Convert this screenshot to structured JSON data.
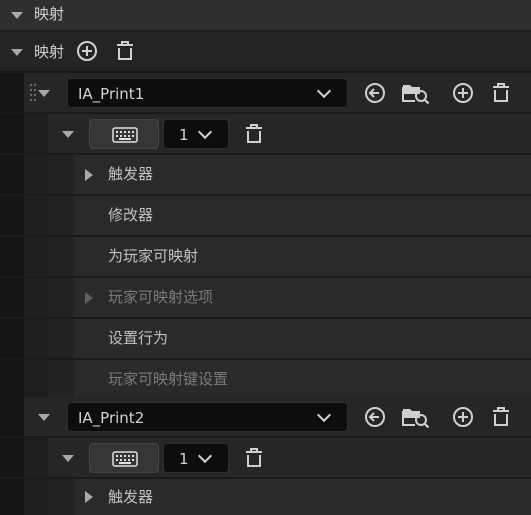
{
  "header": {
    "title": "映射"
  },
  "mappings": {
    "label": "映射"
  },
  "actions": [
    {
      "name": "IA_Print1",
      "key_count": "1",
      "rows": {
        "triggers": "触发器",
        "modifiers": "修改器",
        "player_mappable": "为玩家可映射",
        "player_mappable_options": "玩家可映射选项",
        "behavior": "设置行为",
        "player_mappable_key_settings": "玩家可映射键设置"
      }
    },
    {
      "name": "IA_Print2",
      "key_count": "1",
      "rows": {
        "triggers": "触发器"
      }
    }
  ],
  "colors": {
    "background": "#1b1b1b",
    "row": "#242424",
    "row_alt": "#2a2a2a",
    "dropdown": "#0d0d0d",
    "text": "#c0c0c0",
    "text_dim": "#7a7a7a"
  },
  "icons": [
    "triangle-down-icon",
    "triangle-right-icon",
    "plus-circle-icon",
    "trash-icon",
    "drag-handle-icon",
    "back-arrow-circle-icon",
    "folder-search-icon",
    "keyboard-icon",
    "chevron-down-icon"
  ]
}
